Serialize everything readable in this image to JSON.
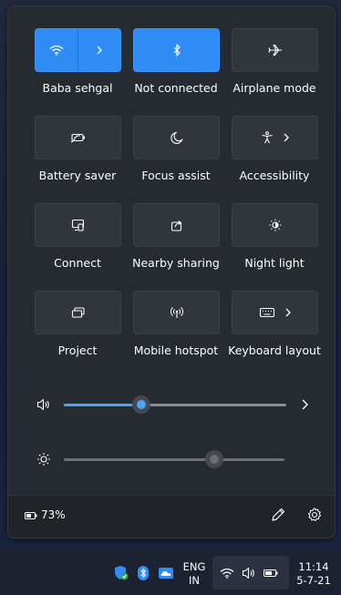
{
  "tiles": [
    {
      "label": "Baba sehgal",
      "icon": "wifi-icon",
      "active": true,
      "has_chevron": true
    },
    {
      "label": "Not connected",
      "icon": "bluetooth-icon",
      "active": true,
      "has_chevron": false
    },
    {
      "label": "Airplane mode",
      "icon": "airplane-icon",
      "active": false,
      "has_chevron": false
    },
    {
      "label": "Battery saver",
      "icon": "battery-saver-icon",
      "active": false,
      "has_chevron": false
    },
    {
      "label": "Focus assist",
      "icon": "moon-icon",
      "active": false,
      "has_chevron": false
    },
    {
      "label": "Accessibility",
      "icon": "accessibility-icon",
      "active": false,
      "has_chevron": true
    },
    {
      "label": "Connect",
      "icon": "cast-icon",
      "active": false,
      "has_chevron": false
    },
    {
      "label": "Nearby sharing",
      "icon": "share-icon",
      "active": false,
      "has_chevron": false
    },
    {
      "label": "Night light",
      "icon": "night-light-icon",
      "active": false,
      "has_chevron": false
    },
    {
      "label": "Project",
      "icon": "project-icon",
      "active": false,
      "has_chevron": false
    },
    {
      "label": "Mobile hotspot",
      "icon": "hotspot-icon",
      "active": false,
      "has_chevron": false
    },
    {
      "label": "Keyboard layout",
      "icon": "keyboard-icon",
      "active": false,
      "has_chevron": true
    }
  ],
  "volume": {
    "icon": "speaker-icon",
    "level": 0.35
  },
  "brightness": {
    "icon": "sun-icon",
    "level": 0.68
  },
  "battery": {
    "percent": "73%",
    "icon": "battery-icon"
  },
  "footer": {
    "edit_icon": "pencil-icon",
    "settings_icon": "gear-icon"
  },
  "taskbar": {
    "language_line1": "ENG",
    "language_line2": "IN",
    "time": "11:14",
    "date": "5-7-21"
  },
  "colors": {
    "accent": "#2f8cf5",
    "panel": "#262a31",
    "tile": "#31353c"
  }
}
